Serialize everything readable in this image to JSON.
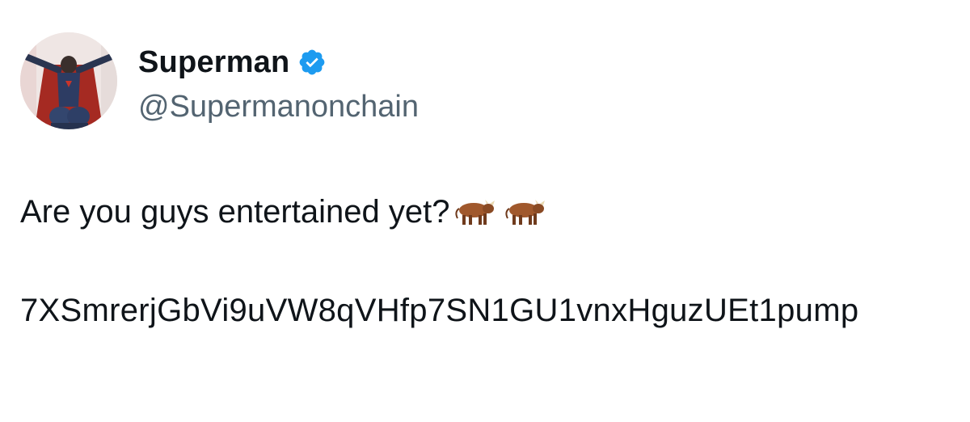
{
  "author": {
    "display_name": "Superman",
    "handle": "@Supermanonchain",
    "verified": true,
    "avatar": "superman-avatar"
  },
  "tweet": {
    "text": "Are you guys entertained yet?",
    "emojis": [
      "ox-emoji",
      "ox-emoji"
    ],
    "address": "7XSmrerjGbVi9uVW8qVHfp7SN1GU1vnxHguzUEt1pump"
  },
  "colors": {
    "verified_blue": "#1d9bf0",
    "handle_gray": "#536471",
    "text": "#0f1419"
  }
}
